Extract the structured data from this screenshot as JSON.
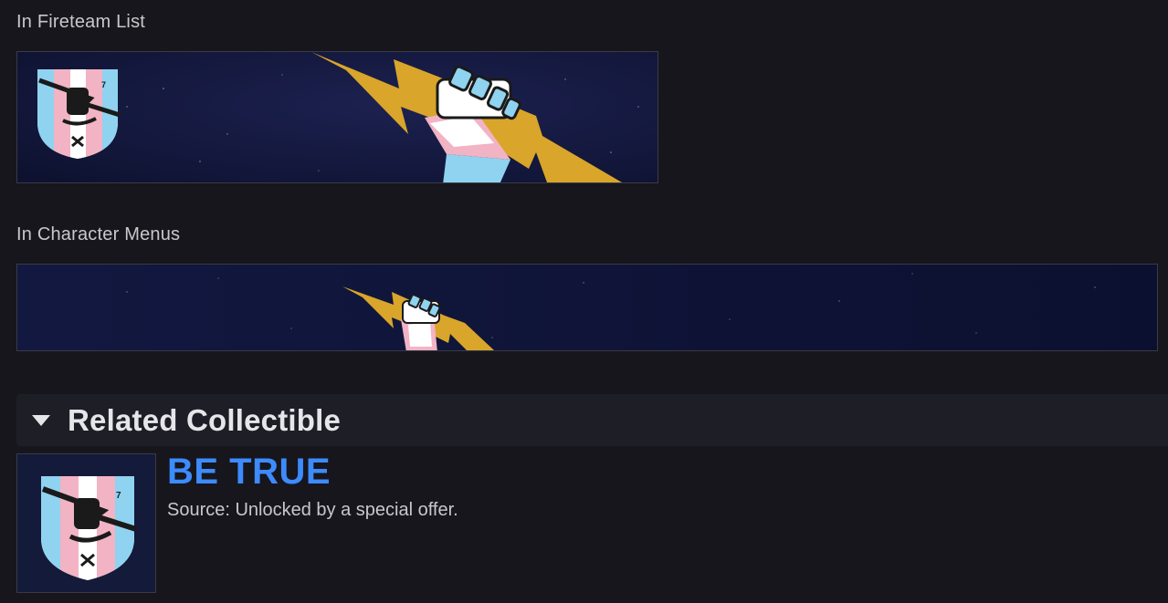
{
  "sections": {
    "fireteam_label": "In Fireteam List",
    "character_label": "In Character Menus"
  },
  "related": {
    "title": "Related Collectible",
    "item": {
      "name": "BE TRUE",
      "source": "Source: Unlocked by a special offer.",
      "emblem_number": "7"
    }
  },
  "colors": {
    "background": "#16161c",
    "banner_bg": "#0f1430",
    "bolt": "#d9a52a",
    "trans_blue": "#8fd3f0",
    "trans_pink": "#f2b3c4",
    "trans_white": "#ffffff",
    "collectible_name": "#3d8bfd"
  },
  "icons": {
    "caret": "caret-down-icon",
    "emblem": "trans-shield-emblem",
    "fist": "fist-with-lightning-icon"
  }
}
